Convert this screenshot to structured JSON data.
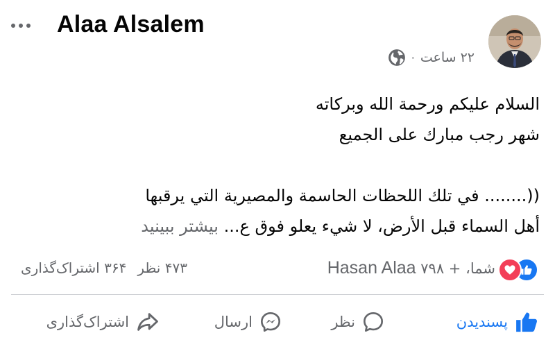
{
  "post": {
    "author": "Alaa Alsalem",
    "time": "۲۲ ساعت",
    "meta_separator": "·",
    "lines": [
      "السلام عليكم ورحمة الله وبركاته",
      "شهر رجب مبارك على الجميع",
      "",
      "((........ في تلك اللحظات الحاسمة والمصيرية التي يرقبها",
      "أهل السماء قبل الأرض، لا شيء يعلو فوق ع..."
    ],
    "see_more": "بیشتر ببینید"
  },
  "reactions": {
    "summary_prefix": "شما،",
    "summary_name": "Hasan Alaa",
    "summary_plus": "+ ۷۹۸",
    "comments": "۴۷۳ نظر",
    "shares": "۳۶۴ اشتراک‌گذاری"
  },
  "actions": {
    "like": "پسندیدن",
    "comment": "نظر",
    "send": "ارسال",
    "share": "اشتراک‌گذاری"
  },
  "colors": {
    "accent": "#1877f2",
    "love": "#f33e58",
    "secondary_text": "#65676b",
    "text": "#050505",
    "divider": "#ced0d4"
  },
  "icons": [
    "more-icon",
    "globe-icon",
    "like-reaction-icon",
    "love-reaction-icon",
    "like-icon",
    "comment-icon",
    "messenger-icon",
    "share-icon"
  ]
}
